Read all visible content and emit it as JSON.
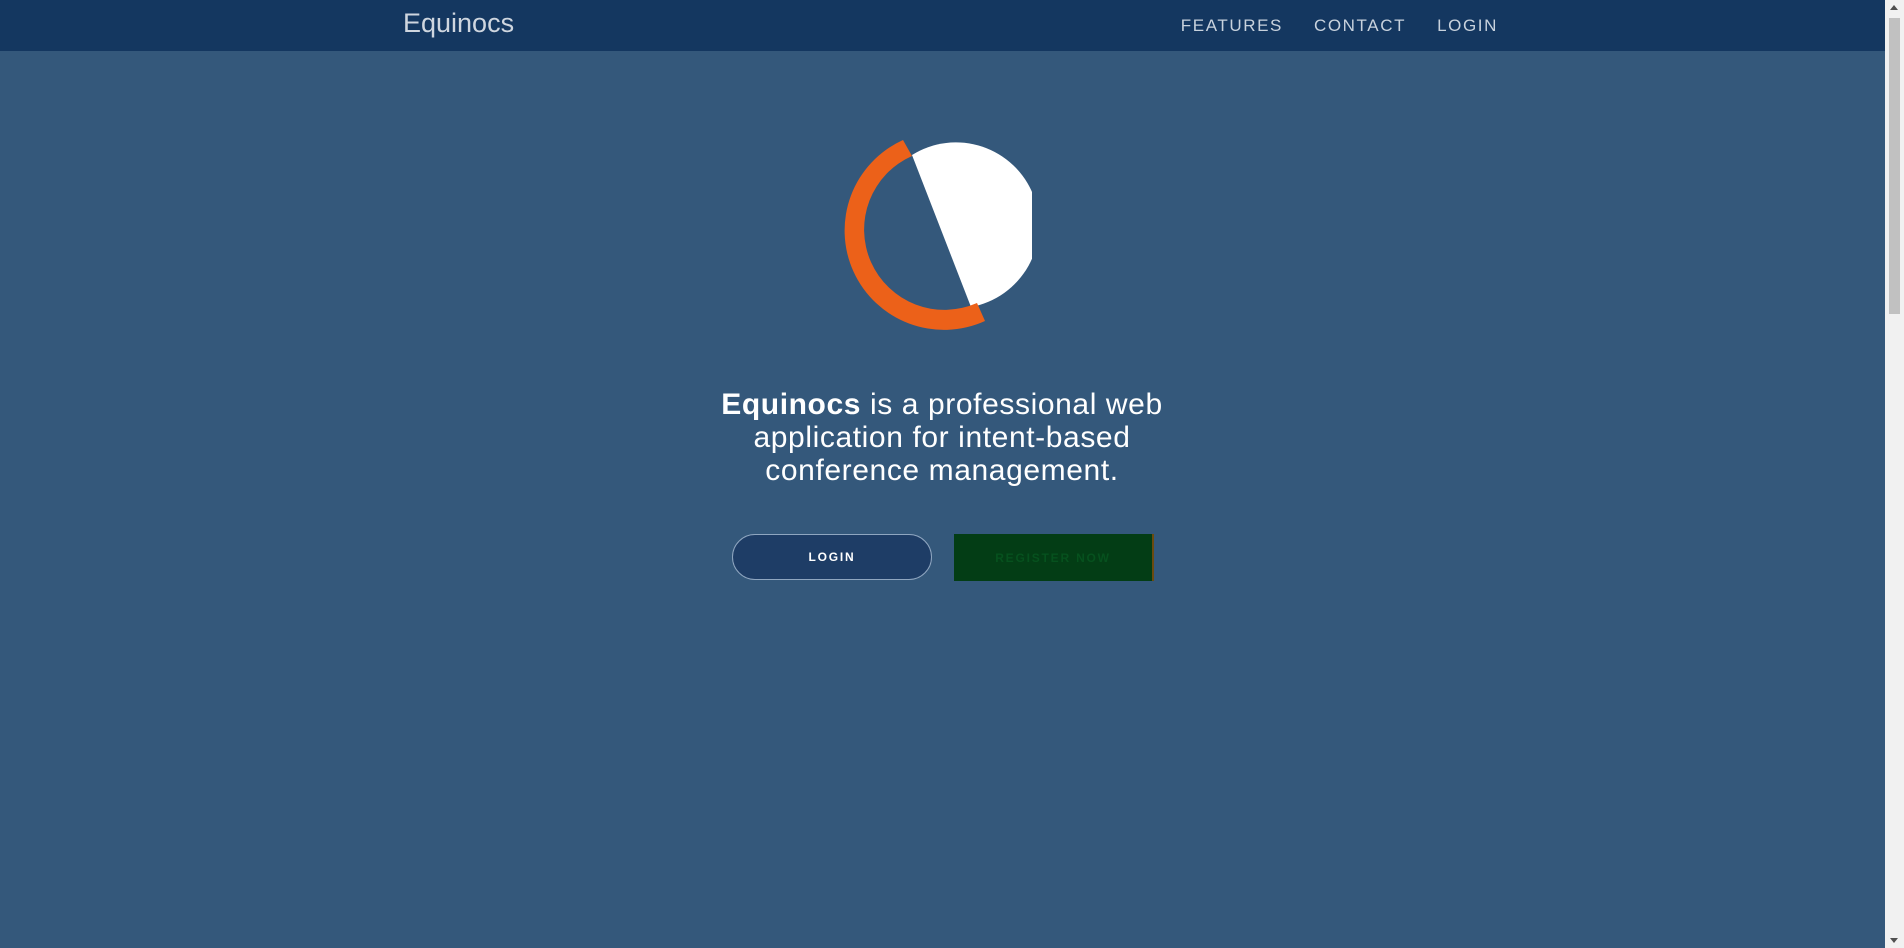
{
  "nav": {
    "brand": "Equinocs",
    "links": [
      "FEATURES",
      "CONTACT",
      "LOGIN"
    ]
  },
  "hero": {
    "logo_icon": "equinocs-logo-icon",
    "headline_bold": "Equinocs",
    "headline_rest": " is a professional web application for intent-based conference management.",
    "login_label": "LOGIN",
    "register_label": "REGISTER NOW"
  },
  "colors": {
    "background": "#34587b",
    "navbar": "#143760",
    "accent_orange": "#ec6119",
    "register_button": "#033d15",
    "login_button": "#1e3d66"
  }
}
